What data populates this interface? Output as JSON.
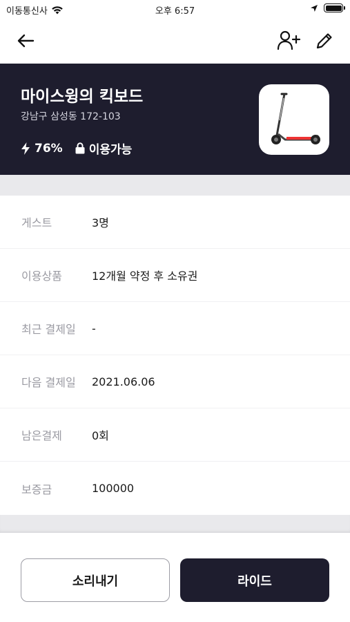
{
  "status_bar": {
    "carrier": "이동통신사",
    "time": "오후 6:57"
  },
  "nav": {
    "back_icon": "arrow-left-icon",
    "add_user_icon": "user-plus-icon",
    "edit_icon": "pencil-icon"
  },
  "hero": {
    "title": "마이스윙의 킥보드",
    "address": "강남구 삼성동 172-103",
    "battery_label": "76%",
    "battery_level": 0.76,
    "lock_status": "이용가능",
    "background_color": "#1e1d2e"
  },
  "details": [
    {
      "label": "게스트",
      "value": "3명"
    },
    {
      "label": "이용상품",
      "value": "12개월 약정 후 소유권"
    },
    {
      "label": "최근 결제일",
      "value": "-"
    },
    {
      "label": "다음 결제일",
      "value": "2021.06.06"
    },
    {
      "label": "남은결제",
      "value": "0회"
    },
    {
      "label": "보증금",
      "value": "100000"
    }
  ],
  "actions": {
    "sound_label": "소리내기",
    "ride_label": "라이드",
    "ride_color": "#1e1d2e"
  }
}
